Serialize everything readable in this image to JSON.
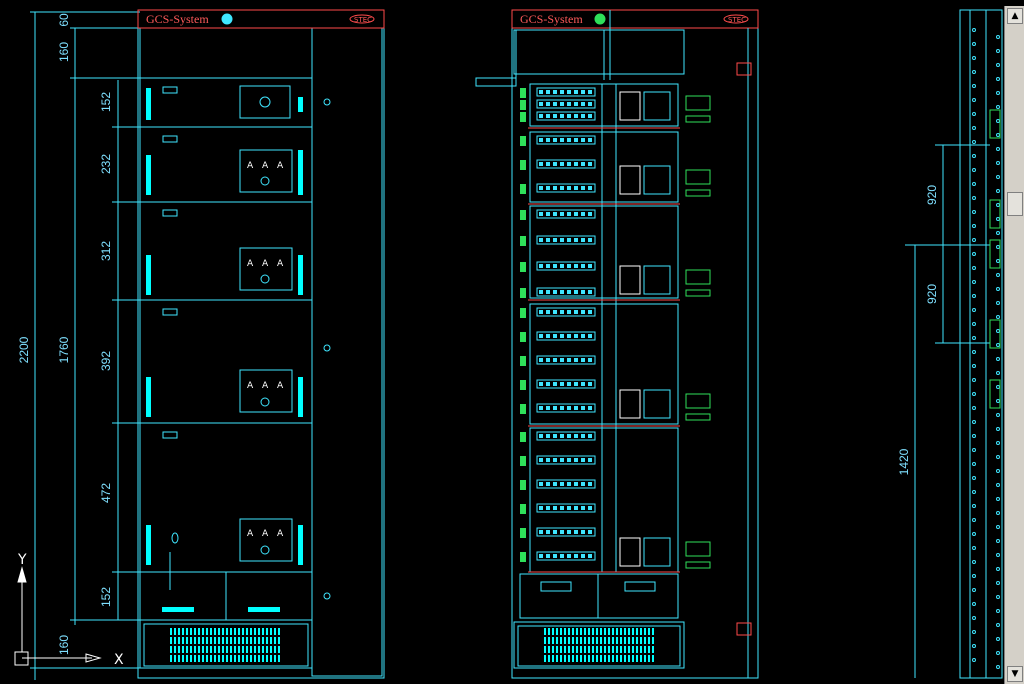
{
  "left_panel": {
    "title": "GCS-System",
    "badge": "STEC",
    "dimensions": {
      "top_margin": "60",
      "header_height": "160",
      "module_1": "152",
      "module_2": "232",
      "module_3": "312",
      "module_4": "392",
      "module_5": "472",
      "bottom_module": "152",
      "base_height": "160",
      "total_height": "2200",
      "inner_height": "1760"
    },
    "meter_labels": [
      "A",
      "A",
      "A"
    ]
  },
  "right_panel": {
    "title": "GCS-System",
    "badge": "STEC"
  },
  "side_panel": {
    "dimensions": [
      "920",
      "920",
      "1420"
    ]
  },
  "axis_icon": {
    "y_label": "Y",
    "x_label": "X"
  },
  "colors": {
    "line": "#3fe6ff",
    "accent": "#ff4a4a",
    "bright": "#00ffff",
    "green": "#2fe05a",
    "white": "#ffffff"
  }
}
